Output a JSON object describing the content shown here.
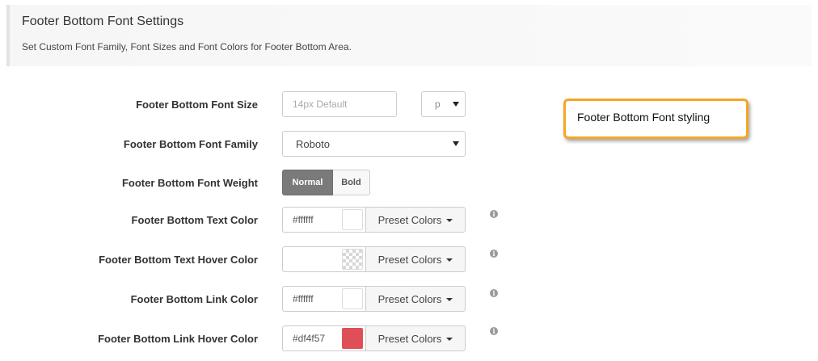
{
  "header": {
    "title": "Footer Bottom Font Settings",
    "description": "Set Custom Font Family, Font Sizes and Font Colors for Footer Bottom Area."
  },
  "font_size": {
    "label": "Footer Bottom Font Size",
    "placeholder": "14px Default",
    "unit_value": "p"
  },
  "font_family": {
    "label": "Footer Bottom Font Family",
    "value": "Roboto"
  },
  "font_weight": {
    "label": "Footer Bottom Font Weight",
    "options": [
      "Normal",
      "Bold"
    ],
    "selected": "Normal"
  },
  "text_color": {
    "label": "Footer Bottom Text Color",
    "value": "#ffffff",
    "swatch": "#ffffff"
  },
  "text_hover_color": {
    "label": "Footer Bottom Text Hover Color",
    "value": "",
    "swatch": "transparent"
  },
  "link_color": {
    "label": "Footer Bottom Link Color",
    "value": "#ffffff",
    "swatch": "#ffffff"
  },
  "link_hover_color": {
    "label": "Footer Bottom Link Hover Color",
    "value": "#df4f57",
    "swatch": "#df4f57"
  },
  "preset_label": "Preset Colors",
  "info_icon_glyph": "i",
  "callout": {
    "text": "Footer Bottom Font styling",
    "border_color": "#f5a623"
  }
}
